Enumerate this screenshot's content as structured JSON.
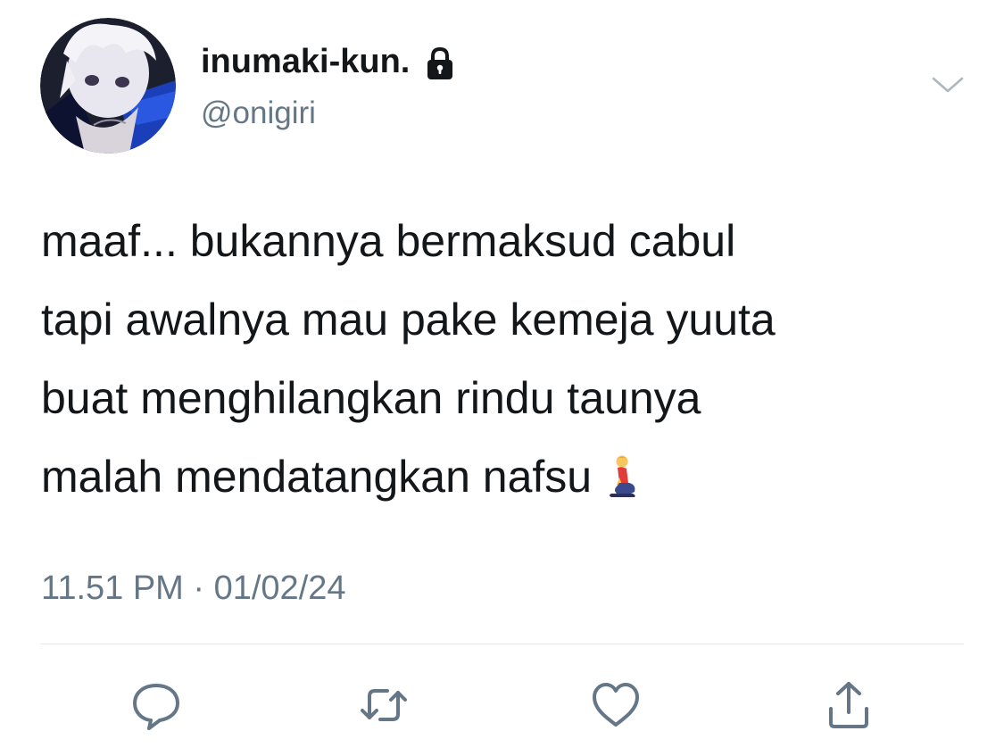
{
  "profile": {
    "display_name": "inumaki-kun.",
    "handle": "@onigiri",
    "locked": true,
    "avatar_icon": "anime-avatar"
  },
  "menu": {
    "icon": "chevron-down-icon"
  },
  "tweet": {
    "lines": [
      "maaf... bukannya bermaksud cabul",
      "tapi awalnya mau pake kemeja yuuta",
      "buat menghilangkan rindu taunya",
      "malah mendatangkan nafsu"
    ],
    "emoji": "kneeling-person-emoji",
    "timestamp": "11.51 PM · 01/02/24"
  },
  "actions": [
    {
      "name": "reply",
      "icon": "reply-icon"
    },
    {
      "name": "retweet",
      "icon": "retweet-icon"
    },
    {
      "name": "like",
      "icon": "heart-icon"
    },
    {
      "name": "share",
      "icon": "share-icon"
    }
  ],
  "colors": {
    "text": "#14171a",
    "secondary": "#657786",
    "divider": "#e1e8ed",
    "icon": "#657786"
  }
}
